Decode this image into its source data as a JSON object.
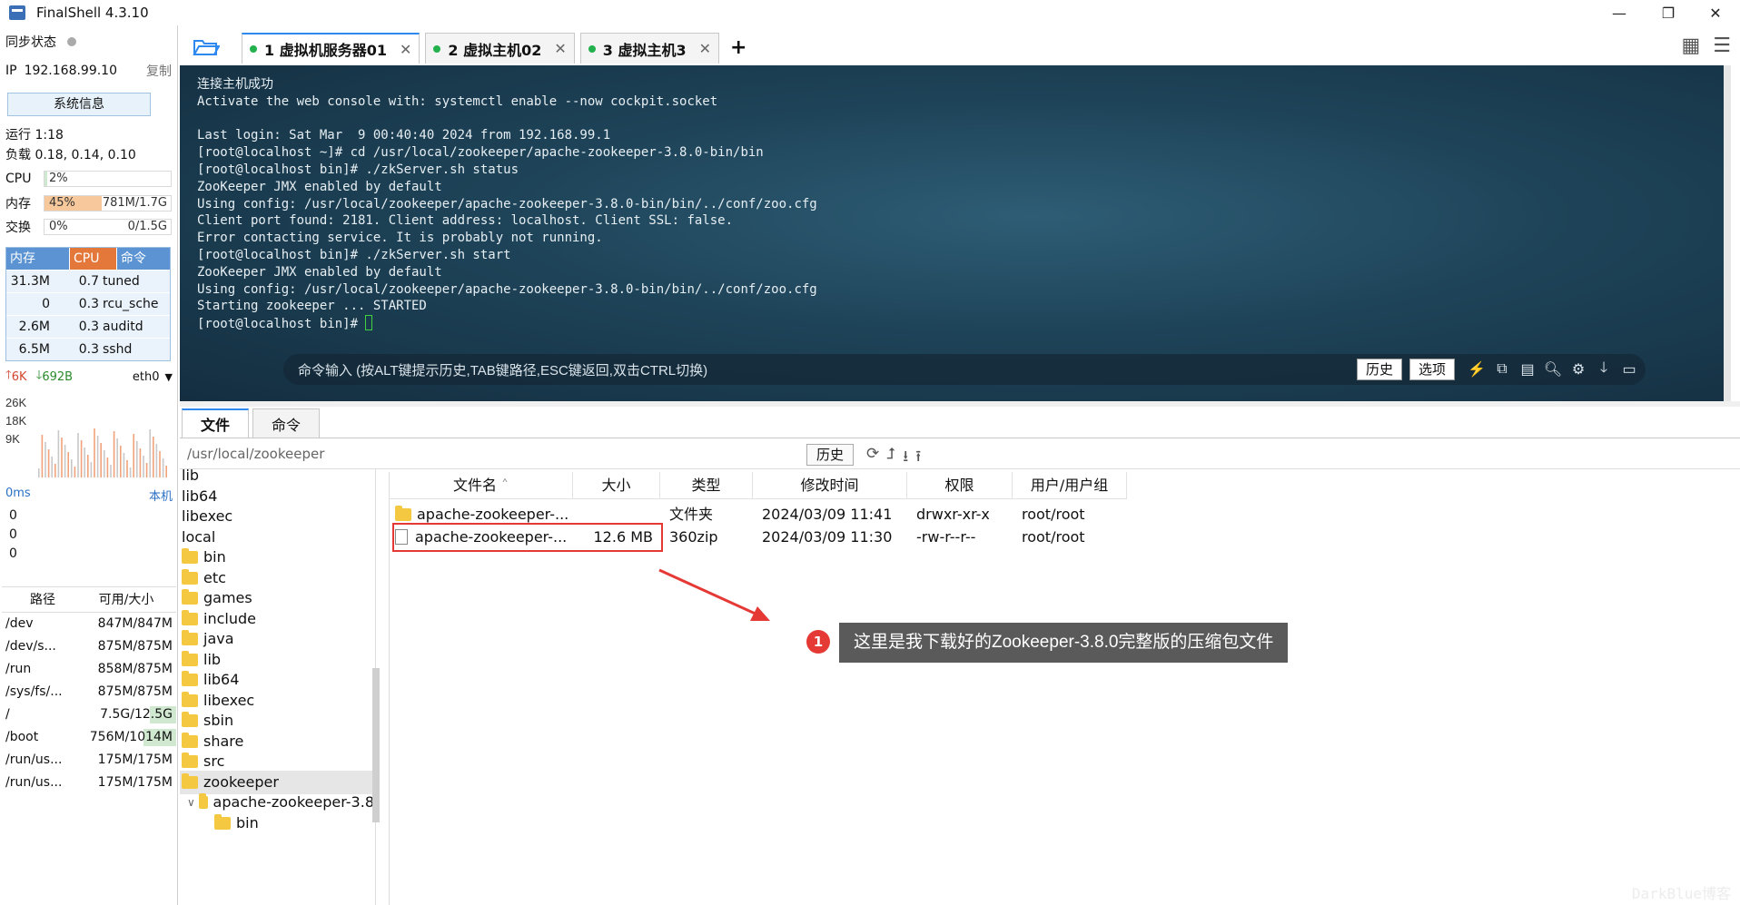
{
  "window": {
    "title": "FinalShell 4.3.10",
    "controls": [
      "—",
      "❐",
      "✕"
    ]
  },
  "sidebar": {
    "sync_label": "同步状态",
    "ip_label": "IP",
    "ip": "192.168.99.10",
    "copy": "复制",
    "sysinfo_button": "系统信息",
    "uptime": "运行 1:18",
    "load": "负载 0.18, 0.14, 0.10",
    "cpu": {
      "label": "CPU",
      "value": "2%",
      "percent": 2
    },
    "mem": {
      "label": "内存",
      "value": "45%",
      "detail": "781M/1.7G",
      "percent": 45
    },
    "swap": {
      "label": "交换",
      "value": "0%",
      "detail": "0/1.5G",
      "percent": 0
    },
    "process_headers": [
      "内存",
      "CPU",
      "命令"
    ],
    "processes": [
      {
        "mem": "31.3M",
        "cpu": "0.7",
        "cmd": "tuned"
      },
      {
        "mem": "0",
        "cpu": "0.3",
        "cmd": "rcu_sche"
      },
      {
        "mem": "2.6M",
        "cpu": "0.3",
        "cmd": "auditd"
      },
      {
        "mem": "6.5M",
        "cpu": "0.3",
        "cmd": "sshd"
      }
    ],
    "net": {
      "up": "6K",
      "down": "692B",
      "iface": "eth0",
      "ticks": [
        "26K",
        "18K",
        "9K"
      ]
    },
    "ping": {
      "label": "0ms",
      "host": "本机",
      "values": [
        "0",
        "0",
        "0"
      ]
    },
    "disk_headers": [
      "路径",
      "可用/大小"
    ],
    "disks": [
      {
        "path": "/dev",
        "size": "847M/847M"
      },
      {
        "path": "/dev/s...",
        "size": "875M/875M"
      },
      {
        "path": "/run",
        "size": "858M/875M"
      },
      {
        "path": "/sys/fs/...",
        "size": "875M/875M"
      },
      {
        "path": "/",
        "size": "7.5G/12.5G",
        "used_percent": 40
      },
      {
        "path": "/boot",
        "size": "756M/1014M",
        "used_percent": 25
      },
      {
        "path": "/run/us...",
        "size": "175M/175M"
      },
      {
        "path": "/run/us...",
        "size": "175M/175M"
      }
    ]
  },
  "tabs": [
    {
      "label": "1 虚拟机服务器01",
      "active": true
    },
    {
      "label": "2 虚拟主机02",
      "active": false
    },
    {
      "label": "3 虚拟主机3",
      "active": false
    }
  ],
  "tab_add": "+",
  "terminal": {
    "lines": [
      "连接主机成功",
      "Activate the web console with: systemctl enable --now cockpit.socket",
      "",
      "Last login: Sat Mar  9 00:40:40 2024 from 192.168.99.1",
      "[root@localhost ~]# cd /usr/local/zookeeper/apache-zookeeper-3.8.0-bin/bin",
      "[root@localhost bin]# ./zkServer.sh status",
      "ZooKeeper JMX enabled by default",
      "Using config: /usr/local/zookeeper/apache-zookeeper-3.8.0-bin/bin/../conf/zoo.cfg",
      "Client port found: 2181. Client address: localhost. Client SSL: false.",
      "Error contacting service. It is probably not running.",
      "[root@localhost bin]# ./zkServer.sh start",
      "ZooKeeper JMX enabled by default",
      "Using config: /usr/local/zookeeper/apache-zookeeper-3.8.0-bin/bin/../conf/zoo.cfg",
      "Starting zookeeper ... STARTED"
    ],
    "prompt": "[root@localhost bin]# ",
    "cmd_placeholder": "命令输入 (按ALT键提示历史,TAB键路径,ESC键返回,双击CTRL切换)",
    "history_button": "历史",
    "options_button": "选项"
  },
  "bottom_tabs": [
    "文件",
    "命令"
  ],
  "path": {
    "current": "/usr/local/zookeeper",
    "history_button": "历史"
  },
  "tree": [
    {
      "label": "lib",
      "indent": 0,
      "folder": false
    },
    {
      "label": "lib64",
      "indent": 0,
      "folder": false
    },
    {
      "label": "libexec",
      "indent": 0,
      "folder": false
    },
    {
      "label": "local",
      "indent": 0,
      "folder": false
    },
    {
      "label": "bin",
      "indent": 1,
      "folder": true
    },
    {
      "label": "etc",
      "indent": 1,
      "folder": true
    },
    {
      "label": "games",
      "indent": 1,
      "folder": true
    },
    {
      "label": "include",
      "indent": 1,
      "folder": true
    },
    {
      "label": "java",
      "indent": 1,
      "folder": true
    },
    {
      "label": "lib",
      "indent": 1,
      "folder": true
    },
    {
      "label": "lib64",
      "indent": 1,
      "folder": true
    },
    {
      "label": "libexec",
      "indent": 1,
      "folder": true
    },
    {
      "label": "sbin",
      "indent": 1,
      "folder": true
    },
    {
      "label": "share",
      "indent": 1,
      "folder": true
    },
    {
      "label": "src",
      "indent": 1,
      "folder": true
    },
    {
      "label": "zookeeper",
      "indent": 1,
      "folder": true,
      "selected": true
    },
    {
      "label": "apache-zookeeper-3.8",
      "indent": 2,
      "folder": true,
      "expanded": true
    },
    {
      "label": "bin",
      "indent": 3,
      "folder": true
    }
  ],
  "files": {
    "headers": [
      "文件名",
      "大小",
      "类型",
      "修改时间",
      "权限",
      "用户/用户组"
    ],
    "rows": [
      {
        "name": "apache-zookeeper-...",
        "size": "",
        "type": "文件夹",
        "mtime": "2024/03/09 11:41",
        "perm": "drwxr-xr-x",
        "owner": "root/root",
        "folder": true
      },
      {
        "name": "apache-zookeeper-...",
        "size": "12.6 MB",
        "type": "360zip",
        "mtime": "2024/03/09 11:30",
        "perm": "-rw-r--r--",
        "owner": "root/root",
        "folder": false
      }
    ]
  },
  "annotation": {
    "number": "1",
    "text": "这里是我下载好的Zookeeper-3.8.0完整版的压缩包文件",
    "color": "#e53935"
  },
  "watermark": "DarkBlue博客"
}
